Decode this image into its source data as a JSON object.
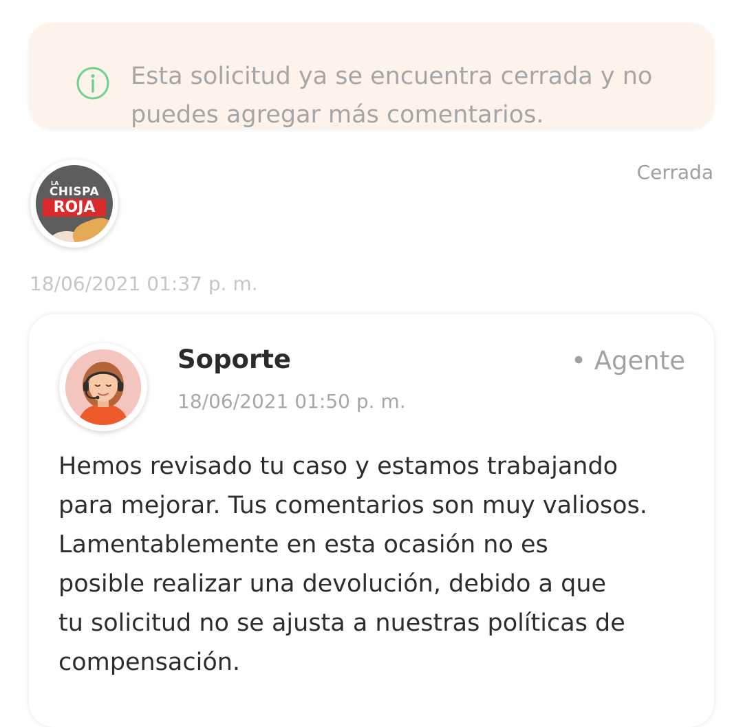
{
  "banner": {
    "icon": "info-icon",
    "message": "Esta solicitud ya se encuentra cerrada y no puedes agregar más comentarios.",
    "icon_color": "#6cd18a",
    "background": "#fef3eb"
  },
  "request": {
    "logo": {
      "name": "La Chispa Roja logo",
      "line1": "LA",
      "line2": "CHISPA",
      "line3": "ROJA"
    },
    "status": "Cerrada",
    "created_at": "18/06/2021 01:37 p. m."
  },
  "comment": {
    "author": "Soporte",
    "role": "• Agente",
    "date": "18/06/2021 01:50 p. m.",
    "avatar": "support-agent-avatar",
    "body": "Hemos revisado tu caso y estamos trabajando\npara mejorar. Tus comentarios son muy valiosos.\nLamentablemente en esta ocasión no es\nposible realizar una devolución, debido a que\ntu solicitud no se ajusta a nuestras políticas de\ncompensación."
  }
}
